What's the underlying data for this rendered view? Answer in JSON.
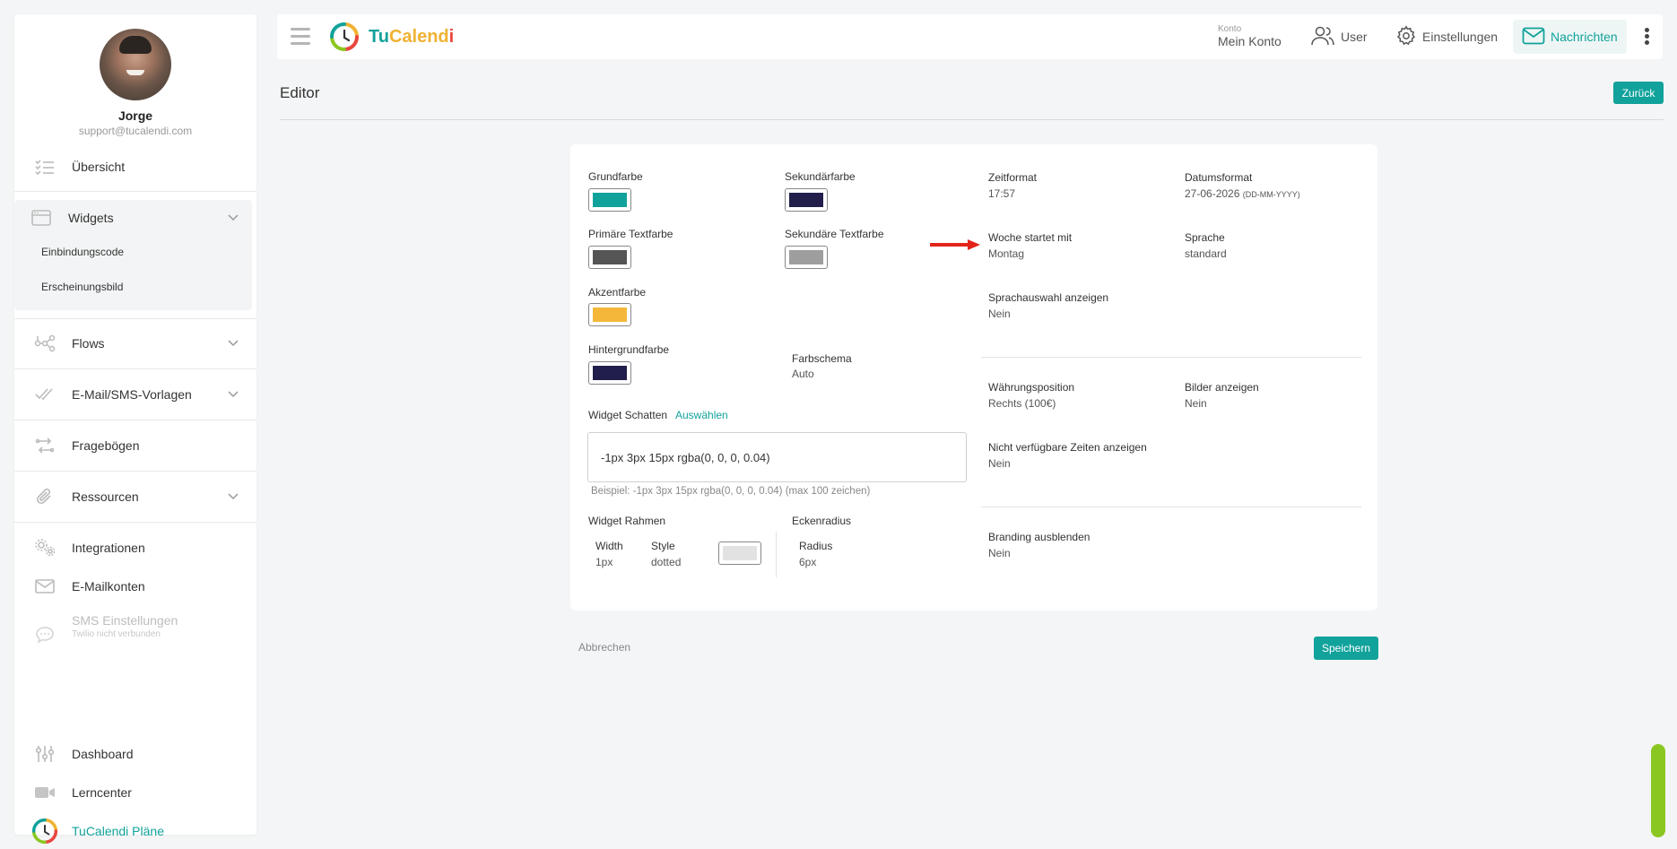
{
  "sidebar": {
    "profile": {
      "name": "Jorge",
      "email": "support@tucalendi.com"
    },
    "items": {
      "uebersicht": "Übersicht",
      "widgets": "Widgets",
      "einbindungscode": "Einbindungscode",
      "erscheinungsbild": "Erscheinungsbild",
      "flows": "Flows",
      "vorlagen": "E-Mail/SMS-Vorlagen",
      "frageboegen": "Fragebögen",
      "ressourcen": "Ressourcen",
      "integrationen": "Integrationen",
      "emailkonten": "E-Mailkonten",
      "sms": "SMS Einstellungen",
      "sms_sub": "Twilio nicht verbunden",
      "dashboard": "Dashboard",
      "lerncenter": "Lerncenter",
      "plaene": "TuCalendi Pläne"
    }
  },
  "topbar": {
    "brand_tu": "Tu",
    "brand_cal": "Calend",
    "brand_i": "i",
    "konto_small": "Konto",
    "konto_main": "Mein Konto",
    "user": "User",
    "einstellungen": "Einstellungen",
    "nachrichten": "Nachrichten"
  },
  "page": {
    "title": "Editor",
    "back": "Zurück"
  },
  "editor": {
    "grundfarbe": {
      "label": "Grundfarbe",
      "color": "#11a29b"
    },
    "sekundaerfarbe": {
      "label": "Sekundärfarbe",
      "color": "#221e4b"
    },
    "primaere_textfarbe": {
      "label": "Primäre Textfarbe",
      "color": "#555555"
    },
    "sekundaere_textfarbe": {
      "label": "Sekundäre Textfarbe",
      "color": "#9e9e9e"
    },
    "akzentfarbe": {
      "label": "Akzentfarbe",
      "color": "#f4b73a"
    },
    "hintergrundfarbe": {
      "label": "Hintergrundfarbe",
      "color": "#221e4b"
    },
    "farbschema": {
      "label": "Farbschema",
      "value": "Auto"
    },
    "widget_schatten": {
      "label": "Widget Schatten",
      "link": "Auswählen",
      "value": "-1px 3px 15px rgba(0, 0, 0, 0.04)",
      "hint": "Beispiel: -1px 3px 15px rgba(0, 0, 0, 0.04) (max 100 zeichen)"
    },
    "widget_rahmen": {
      "label": "Widget Rahmen",
      "width_label": "Width",
      "width_value": "1px",
      "style_label": "Style",
      "style_value": "dotted",
      "color": "#e2e2e2"
    },
    "eckenradius": {
      "label": "Eckenradius",
      "radius_label": "Radius",
      "radius_value": "6px"
    },
    "zeitformat": {
      "label": "Zeitformat",
      "value": "17:57"
    },
    "datumsformat": {
      "label": "Datumsformat",
      "value": "27-06-2026",
      "format": "(DD-MM-YYYY)"
    },
    "woche": {
      "label": "Woche startet mit",
      "value": "Montag"
    },
    "sprache": {
      "label": "Sprache",
      "value": "standard"
    },
    "sprachauswahl": {
      "label": "Sprachauswahl anzeigen",
      "value": "Nein"
    },
    "waehrungsposition": {
      "label": "Währungsposition",
      "value": "Rechts (100€)"
    },
    "bilder": {
      "label": "Bilder anzeigen",
      "value": "Nein"
    },
    "nicht_verfuegbar": {
      "label": "Nicht verfügbare Zeiten anzeigen",
      "value": "Nein"
    },
    "branding": {
      "label": "Branding ausblenden",
      "value": "Nein"
    }
  },
  "actions": {
    "cancel": "Abbrechen",
    "save": "Speichern"
  },
  "colors": {
    "accent": "#11a29b",
    "arrow": "#e3241b",
    "scrollbar": "#8bc721"
  }
}
